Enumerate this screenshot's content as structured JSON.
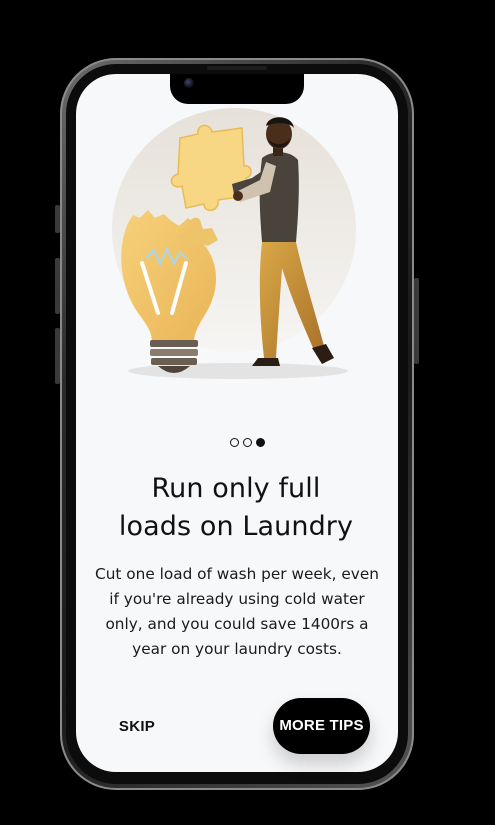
{
  "onboarding": {
    "title_line1": "Run only full",
    "title_line2": "loads on Laundry",
    "body_line1": "Cut one load of wash per week, even",
    "body_line2": "if you're already using cold water",
    "body_line3": "only, and you could save 1400rs a",
    "body_line4": "year on your laundry costs.",
    "pager": {
      "total": 3,
      "current": 3
    },
    "skip_label": "SKIP",
    "more_tips_label": "MORE TIPS"
  },
  "illustration": {
    "icons": [
      "man-figure-icon",
      "puzzle-piece-icon",
      "lightbulb-icon"
    ],
    "colors": {
      "accent": "#f5c85a",
      "shirt": "#4a433c",
      "pants": "#c9953e",
      "backdrop": "#ebe7e1"
    }
  }
}
